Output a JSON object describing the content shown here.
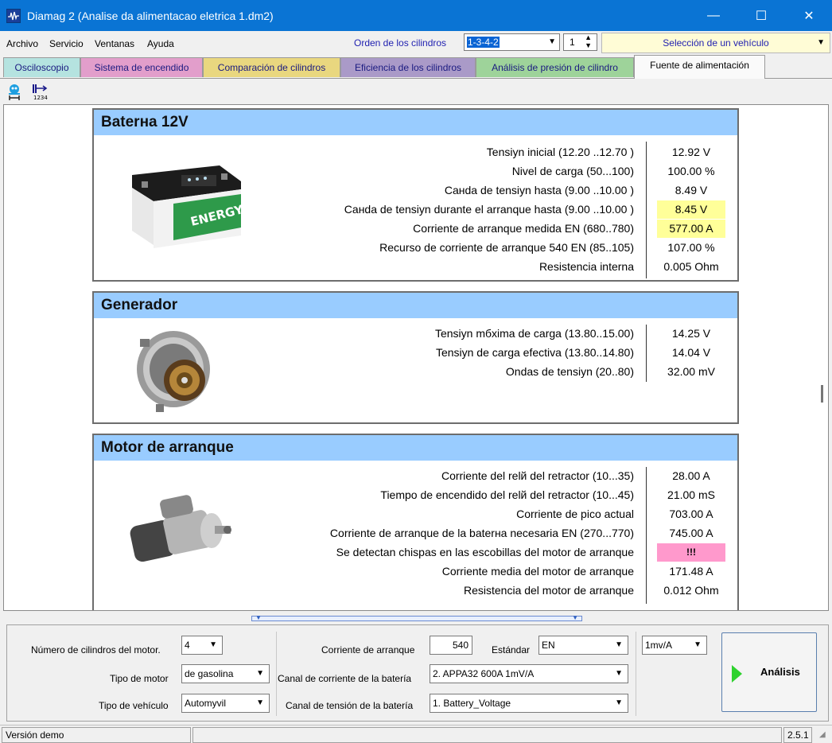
{
  "window": {
    "title": "Diamag 2 (Analise da alimentacao eletrica 1.dm2)",
    "minimize": "—",
    "maximize": "☐",
    "close": "✕"
  },
  "menu": {
    "items": [
      "Archivo",
      "Servicio",
      "Ventanas",
      "Ayuda"
    ],
    "cylinder_order_label": "Orden de los cilindros",
    "cylinder_order_value": "1-3-4-2",
    "cylinder_number_value": "1",
    "vehicle_select": "Selección de un vehículo"
  },
  "tabs": [
    {
      "label": "Osciloscopio",
      "color": "#b5e3e0"
    },
    {
      "label": "Sistema de encendido",
      "color": "#e29ecb"
    },
    {
      "label": "Comparación de cilindros",
      "color": "#e9d77f"
    },
    {
      "label": "Eficiencia de los cilindros",
      "color": "#aa9ac8"
    },
    {
      "label": "Análisis de presión de cilindro",
      "color": "#9ed39a"
    },
    {
      "label": "Fuente de alimentación",
      "color": "#fafafa",
      "active": true
    }
  ],
  "battery": {
    "title": "Baterнa 12V",
    "rows": [
      {
        "label": "Tensiуn inicial (12.20 ..12.70 )",
        "value": "12.92 V",
        "highlight": ""
      },
      {
        "label": "Nivel de carga (50...100)",
        "value": "100.00 %",
        "highlight": ""
      },
      {
        "label": "Caнda de tensiуn hasta (9.00 ..10.00 )",
        "value": "8.49 V",
        "highlight": ""
      },
      {
        "label": "Caнda de tensiуn durante el arranque hasta (9.00 ..10.00 )",
        "value": "8.45 V",
        "highlight": "yellow"
      },
      {
        "label": "Corriente de arranque medida  EN (680..780)",
        "value": "577.00 A",
        "highlight": "yellow"
      },
      {
        "label": "Recurso de corriente de arranque  540 EN (85..105)",
        "value": "107.00 %",
        "highlight": ""
      },
      {
        "label": "Resistencia interna",
        "value": "0.005 Ohm",
        "highlight": ""
      }
    ],
    "image_text": "ENERGY"
  },
  "generator": {
    "title": "Generador",
    "rows": [
      {
        "label": "Tensiуn mбxima de carga  (13.80..15.00)",
        "value": "14.25 V",
        "highlight": ""
      },
      {
        "label": "Tensiуn de carga efectiva (13.80..14.80)",
        "value": "14.04 V",
        "highlight": ""
      },
      {
        "label": "Ondas de tensiуn (20..80)",
        "value": "32.00 mV",
        "highlight": ""
      }
    ]
  },
  "starter": {
    "title": "Motor de arranque",
    "rows": [
      {
        "label": "Corriente del relй del retractor (10...35)",
        "value": "28.00 A",
        "highlight": ""
      },
      {
        "label": "Tiempo de encendido del relй del retractor (10...45)",
        "value": "21.00 mS",
        "highlight": ""
      },
      {
        "label": "Corriente de pico actual",
        "value": "703.00 A",
        "highlight": ""
      },
      {
        "label": "Corriente de arranque de la baterнa necesaria  EN (270...770)",
        "value": "745.00 A",
        "highlight": ""
      },
      {
        "label": "Se detectan chispas en las escobillas del motor de arranque",
        "value": "!!!",
        "highlight": "pink"
      },
      {
        "label": "Corriente media del motor de arranque",
        "value": "171.48 A",
        "highlight": ""
      },
      {
        "label": "Resistencia del motor de arranque",
        "value": "0.012 Ohm",
        "highlight": ""
      }
    ]
  },
  "settings": {
    "cylinders_label": "Número de cilindros del motor.",
    "cylinders_value": "4",
    "engine_type_label": "Tipo de motor",
    "engine_type_value": "de gasolina",
    "vehicle_type_label": "Tipo de vehículo",
    "vehicle_type_value": "Automуvil",
    "cranking_current_label": "Corriente de arranque",
    "cranking_current_value": "540",
    "standard_label": "Estándar",
    "standard_value": "EN",
    "current_channel_label": "Canal de corriente de la batería",
    "current_channel_value": "2.  APPA32 600A 1mV/A",
    "voltage_channel_label": "Canal de tensión de la batería",
    "voltage_channel_value": "1.  Battery_Voltage",
    "scale_value": "1mv/A",
    "analysis_button": "Análisis"
  },
  "status": {
    "left": "Versión demo",
    "version": "2.5.1"
  }
}
